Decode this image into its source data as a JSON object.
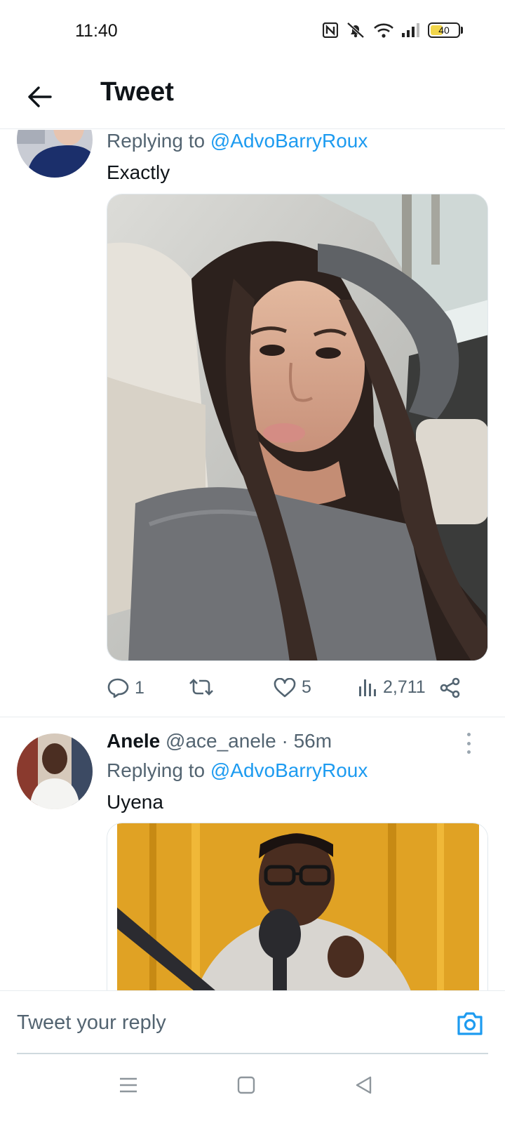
{
  "status_bar": {
    "time": "11:40",
    "battery_level": "40",
    "icons": [
      "nfc-icon",
      "mute-icon",
      "wifi-icon",
      "signal-icon",
      "battery-icon"
    ]
  },
  "header": {
    "title": "Tweet",
    "back_icon": "arrow-left-icon"
  },
  "tweets": [
    {
      "reply_prefix": "Replying to",
      "reply_handle": "@AdvoBarryRoux",
      "text": "Exactly",
      "media": "photo",
      "replies": "1",
      "retweets": "",
      "likes": "5",
      "views": "2,711"
    },
    {
      "name": "Anele",
      "handle": "@ace_anele",
      "separator": "·",
      "time": "56m",
      "reply_prefix": "Replying to",
      "reply_handle": "@AdvoBarryRoux",
      "text": "Uyena",
      "media": "photo"
    }
  ],
  "reply_bar": {
    "placeholder": "Tweet your reply",
    "camera_icon": "camera-icon"
  },
  "nav_bar": {
    "icons": [
      "menu-icon",
      "home-square-icon",
      "back-triangle-icon"
    ]
  },
  "colors": {
    "accent": "#1d9bf0",
    "muted": "#536471",
    "text": "#0f1419",
    "divider": "#e8ecef"
  }
}
